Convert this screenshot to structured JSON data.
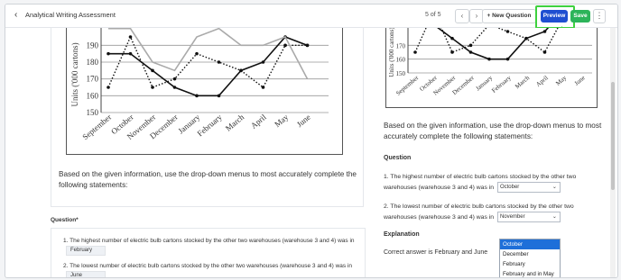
{
  "header": {
    "back_icon": "chevron-left-icon",
    "title": "Analytical Writing Assessment",
    "counter": "5 of 5",
    "prev_icon": "chevron-left-icon",
    "next_icon": "chevron-right-icon",
    "new_question": "+ New Question",
    "preview": "Preview",
    "save": "Save",
    "more_icon": "kebab-icon",
    "highlight_color": "#3ed13e"
  },
  "editor": {
    "stem": "Based on the given information, use the drop-down menus to most accurately complete the following statements:",
    "question_label": "Question*",
    "q1_text": "1. The highest number of electric bulb cartons stocked by the other two warehouses (warehouse 3 and 4) was in",
    "q1_value": "February",
    "q2_text": "2. The lowest number of electric bulb cartons stocked by the other two warehouses (warehouse 3 and 4) was in",
    "q2_value": "June"
  },
  "preview_panel": {
    "stem": "Based on the given information, use the drop-down menus to most accurately complete the following statements:",
    "question_label": "Question",
    "q1_text": "1. The highest number of electric bulb cartons stocked by the other two warehouses (warehouse 3 and 4) was in",
    "q1_value": "October",
    "q2_text": "2. The lowest number of electric bulb cartons stocked by the other two warehouses (warehouse 3 and 4) was in",
    "q2_value": "November",
    "explanation_label": "Explanation",
    "answer": "Correct answer is February and June",
    "dropdown_options": [
      "October",
      "December",
      "February",
      "February and in May"
    ]
  },
  "chart_data": [
    {
      "type": "line",
      "ylabel": "Units ('000 cartons)",
      "categories": [
        "September",
        "October",
        "November",
        "December",
        "January",
        "February",
        "March",
        "April",
        "May",
        "June"
      ],
      "yticks": [
        150,
        160,
        170,
        180,
        190
      ],
      "ylim": [
        150,
        195
      ],
      "series": [
        {
          "style": "solid",
          "values": [
            185,
            185,
            175,
            165,
            160,
            160,
            175,
            180,
            195,
            190
          ]
        },
        {
          "style": "dotted",
          "values": [
            165,
            195,
            165,
            170,
            185,
            180,
            175,
            165,
            190,
            190
          ]
        },
        {
          "style": "gray",
          "values": [
            200,
            200,
            180,
            175,
            195,
            200,
            190,
            190,
            195,
            170
          ]
        }
      ]
    },
    {
      "type": "line",
      "ylabel": "Units ('000 cartons)",
      "categories": [
        "September",
        "October",
        "November",
        "December",
        "January",
        "February",
        "March",
        "April",
        "May",
        "June"
      ],
      "yticks": [
        150,
        160,
        170
      ],
      "ylim": [
        150,
        180
      ],
      "series": [
        {
          "style": "solid",
          "values": [
            185,
            185,
            175,
            165,
            160,
            160,
            175,
            180,
            195,
            190
          ]
        },
        {
          "style": "dotted",
          "values": [
            165,
            195,
            165,
            170,
            185,
            180,
            175,
            165,
            190,
            190
          ]
        }
      ]
    }
  ]
}
